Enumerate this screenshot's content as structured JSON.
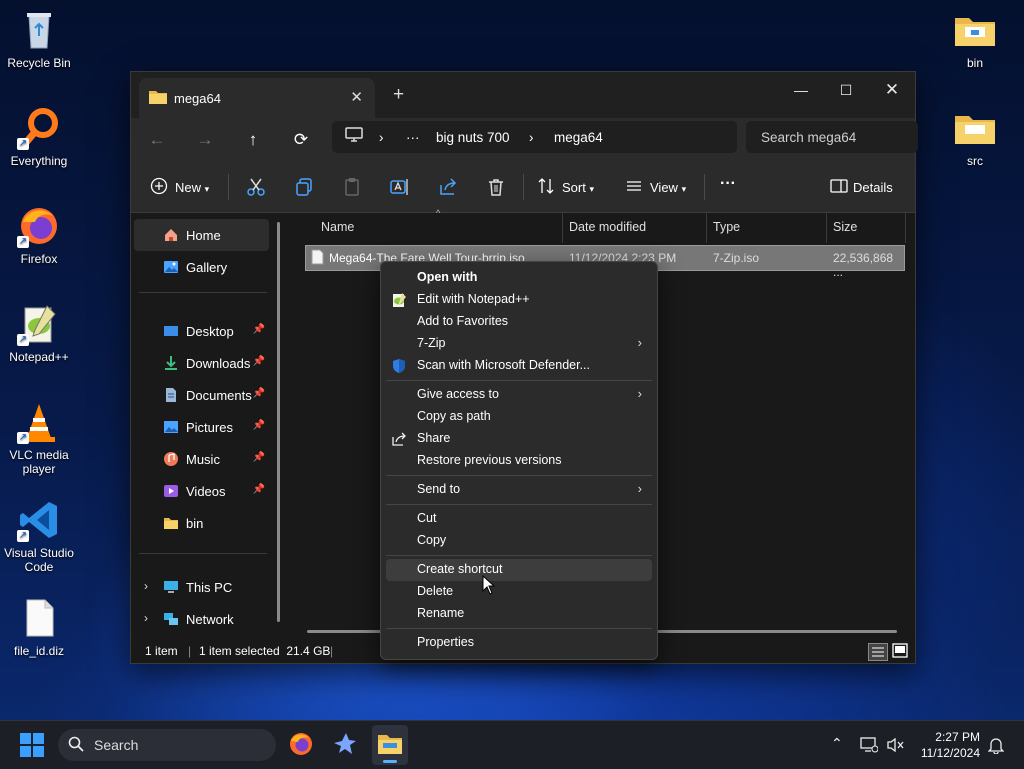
{
  "desktop": {
    "icons": [
      {
        "label": "Recycle Bin"
      },
      {
        "label": "Everything"
      },
      {
        "label": "Firefox"
      },
      {
        "label": "Notepad++"
      },
      {
        "label": "VLC media player"
      },
      {
        "label": "Visual Studio Code"
      },
      {
        "label": "file_id.diz"
      },
      {
        "label": "bin"
      },
      {
        "label": "src"
      }
    ]
  },
  "window": {
    "tab_title": "mega64",
    "new_tab_glyph": "+",
    "address": {
      "overflow": "···",
      "crumbs": [
        "big nuts 700",
        "mega64"
      ]
    },
    "search_placeholder": "Search mega64",
    "toolbar": {
      "new_label": "New",
      "sort_label": "Sort",
      "view_label": "View",
      "more_label": "···",
      "details_label": "Details"
    },
    "sidebar": {
      "top": [
        {
          "label": "Home"
        },
        {
          "label": "Gallery"
        }
      ],
      "quick": [
        {
          "label": "Desktop"
        },
        {
          "label": "Downloads"
        },
        {
          "label": "Documents"
        },
        {
          "label": "Pictures"
        },
        {
          "label": "Music"
        },
        {
          "label": "Videos"
        },
        {
          "label": "bin"
        }
      ],
      "bottom": [
        {
          "label": "This PC"
        },
        {
          "label": "Network"
        }
      ]
    },
    "columns": [
      "Name",
      "Date modified",
      "Type",
      "Size"
    ],
    "files": [
      {
        "name": "Mega64-The Fare Well Tour-brrip.iso",
        "date": "11/12/2024 2:23 PM",
        "type": "7-Zip.iso",
        "size": "22,536,868 ..."
      }
    ],
    "status": {
      "count": "1 item",
      "selected": "1 item selected  21.4 GB"
    }
  },
  "context_menu": {
    "groups": [
      [
        {
          "label": "Open with",
          "bold": true
        },
        {
          "label": "Edit with Notepad++",
          "icon": "notepadpp-icon"
        },
        {
          "label": "Add to Favorites"
        },
        {
          "label": "7-Zip",
          "submenu": true
        },
        {
          "label": "Scan with Microsoft Defender...",
          "icon": "defender-shield-icon"
        }
      ],
      [
        {
          "label": "Give access to",
          "submenu": true
        },
        {
          "label": "Copy as path"
        },
        {
          "label": "Share",
          "icon": "share-icon"
        },
        {
          "label": "Restore previous versions"
        }
      ],
      [
        {
          "label": "Send to",
          "submenu": true
        }
      ],
      [
        {
          "label": "Cut"
        },
        {
          "label": "Copy"
        }
      ],
      [
        {
          "label": "Create shortcut",
          "hover": true
        },
        {
          "label": "Delete"
        },
        {
          "label": "Rename"
        }
      ],
      [
        {
          "label": "Properties"
        }
      ]
    ]
  },
  "taskbar": {
    "search_label": "Search",
    "time": "2:27 PM",
    "date": "11/12/2024"
  }
}
